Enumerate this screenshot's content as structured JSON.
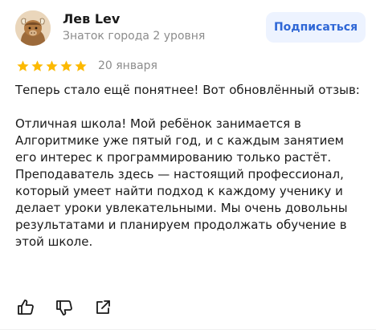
{
  "author": {
    "name": "Лев Lev",
    "level": "Знаток города 2 уровня",
    "avatar_icon": "yak-avatar-icon"
  },
  "subscribe_label": "Подписаться",
  "rating": {
    "stars": 5,
    "max": 5,
    "color": "#fcb900"
  },
  "date": "20 января",
  "review": {
    "intro": "Теперь стало ещё понятнее! Вот обновлённый отзыв:",
    "body": "Отличная школа! Мой ребёнок занимается в Алгоритмике уже пятый год, и с каждым занятием его интерес к программированию только растёт. Преподаватель здесь — настоящий профессионал, который умеет найти подход к каждому ученику и делает уроки увлекательными. Мы очень довольны результатами и планируем продолжать обучение в этой школе."
  },
  "actions": {
    "like_icon": "thumbs-up-icon",
    "dislike_icon": "thumbs-down-icon",
    "share_icon": "share-icon"
  },
  "colors": {
    "accent": "#2f67d6",
    "accent_bg": "#edf3ff",
    "muted_text": "#8c8c8c"
  }
}
